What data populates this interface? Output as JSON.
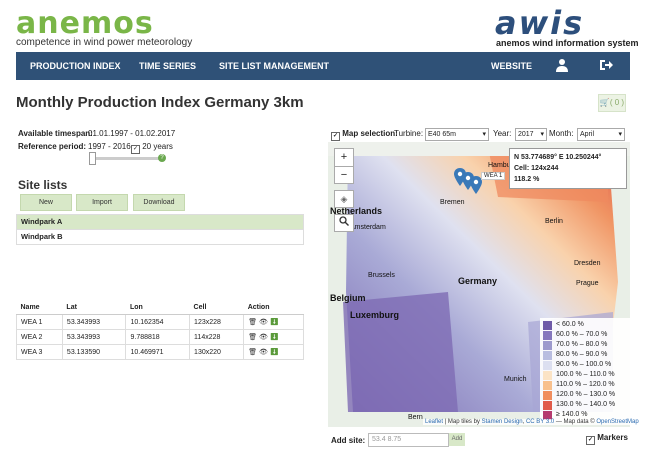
{
  "header": {
    "brand": "anemos",
    "tagline": "competence in wind power meteorology",
    "brand2": "awis",
    "brand2_sub": "anemos wind information system"
  },
  "nav": {
    "items": [
      "PRODUCTION INDEX",
      "TIME SERIES",
      "SITE LIST MANAGEMENT"
    ],
    "website": "WEBSITE",
    "user_icon": "user-icon",
    "logout_icon": "logout-icon"
  },
  "page": {
    "title": "Monthly Production Index Germany 3km",
    "cart_count": "( 0 )"
  },
  "info": {
    "timespan_label": "Available timespan:",
    "timespan_value": "01.01.1997 - 01.02.2017",
    "ref_label": "Reference period:",
    "ref_value": "1997 - 2016",
    "ref_check": "20 years"
  },
  "sites": {
    "title": "Site lists",
    "buttons": [
      "New",
      "Import",
      "Download"
    ],
    "parks": [
      "Windpark A",
      "Windpark B"
    ]
  },
  "table": {
    "headers": [
      "Name",
      "Lat",
      "Lon",
      "Cell",
      "Action"
    ],
    "rows": [
      [
        "WEA 1",
        "53.343993",
        "10.162354",
        "123x228"
      ],
      [
        "WEA 2",
        "53.343993",
        "9.788818",
        "114x228"
      ],
      [
        "WEA 3",
        "53.133590",
        "10.469971",
        "130x220"
      ]
    ]
  },
  "map_ctl": {
    "selection_label": "Map selection:",
    "turbine_label": "Turbine:",
    "turbine_value": "E40 65m",
    "year_label": "Year:",
    "year_value": "2017",
    "month_label": "Month:",
    "month_value": "April"
  },
  "popup": {
    "coords": "N 53.774689° E 10.250244°",
    "cell": "Cell: 124x244",
    "value": "118.2 %",
    "marker_label": "WEA 1"
  },
  "legend": [
    {
      "label": "< 60.0 %",
      "color": "#6e5aa8"
    },
    {
      "label": "60.0 % – 70.0 %",
      "color": "#8577bd"
    },
    {
      "label": "70.0 % – 80.0 %",
      "color": "#9d9acd"
    },
    {
      "label": "80.0 % – 90.0 %",
      "color": "#b9bde0"
    },
    {
      "label": "90.0 % – 100.0 %",
      "color": "#dcdff0"
    },
    {
      "label": "100.0 % – 110.0 %",
      "color": "#fbe3c5"
    },
    {
      "label": "110.0 % – 120.0 %",
      "color": "#f8c08d"
    },
    {
      "label": "120.0 % – 130.0 %",
      "color": "#f08d5e"
    },
    {
      "label": "130.0 % – 140.0 %",
      "color": "#e05a4a"
    },
    {
      "label": "≥ 140.0 %",
      "color": "#b53a6f"
    }
  ],
  "map_labels": {
    "cities": [
      "Bremen",
      "Hamburg",
      "Berlin",
      "Amsterdam",
      "Dresden",
      "Prague",
      "Brussels",
      "Munich",
      "Bern"
    ],
    "countries": [
      "Netherlands",
      "Germany",
      "Belgium",
      "Luxemburg"
    ]
  },
  "attribution": {
    "leaflet": "Leaflet",
    "text1": " | Map tiles by ",
    "stamen": "Stamen Design",
    "text2": ", ",
    "ccby": "CC BY 3.0",
    "text3": " — Map data © ",
    "osm": "OpenStreetMap"
  },
  "add_site": {
    "label": "Add site:",
    "placeholder": "53.4 8.75",
    "button": "Add",
    "markers": "Markers"
  }
}
